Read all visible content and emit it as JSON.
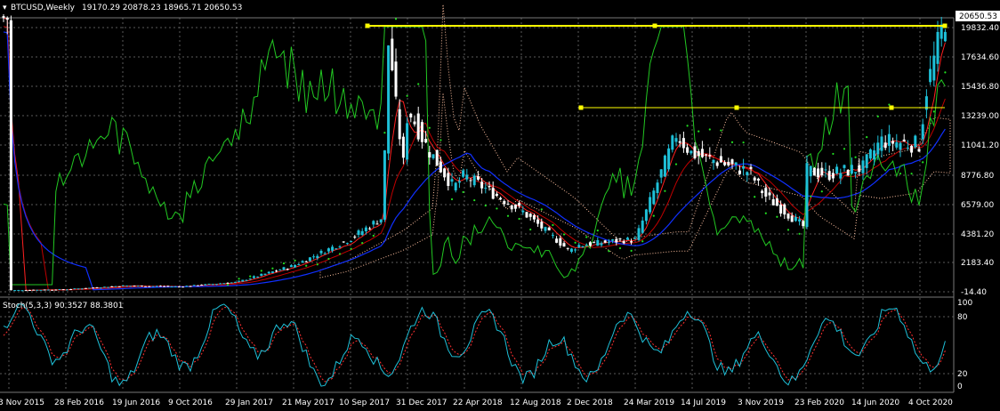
{
  "header": {
    "symbol": "BTCUSD,Weekly",
    "ohlc": "19170.29 20878.23 18965.71 20650.53"
  },
  "stoch": {
    "label": "Stoch(5,3,3) 90.3527 88.3801",
    "levels": [
      "100",
      "80",
      "20",
      "0"
    ]
  },
  "price_axis": [
    "19832.40",
    "17634.60",
    "15436.80",
    "13239.00",
    "11041.20",
    "8776.80",
    "6579.00",
    "4381.20",
    "2183.40",
    "-14.40"
  ],
  "current_price": "20650.53",
  "date_axis": [
    "3 Nov 2015",
    "28 Feb 2016",
    "19 Jun 2016",
    "9 Oct 2016",
    "29 Jan 2017",
    "21 May 2017",
    "10 Sep 2017",
    "31 Dec 2017",
    "22 Apr 2018",
    "12 Aug 2018",
    "2 Dec 2018",
    "24 Mar 2019",
    "14 Jul 2019",
    "3 Nov 2019",
    "23 Feb 2020",
    "14 Jun 2020",
    "4 Oct 2020"
  ],
  "colors": {
    "background": "#000000",
    "grid": "#5a5a5a",
    "candle_up": "#1ec0d8",
    "candle_down": "#ffffff",
    "fast_ma": "#ff2020",
    "mid_ma": "#c00000",
    "slow_ma": "#1030ff",
    "momentum": "#22c822",
    "psar": "#22e022",
    "cloud": "#ffc0a0",
    "resistance": "#ffff00",
    "stoch_main": "#1ec0d8",
    "stoch_signal": "#ff3030"
  },
  "chart_data": {
    "type": "candlestick",
    "title": "BTCUSD,Weekly",
    "ylim": [
      -14.4,
      20650.53
    ],
    "x": [
      "3 Nov 2015",
      "28 Feb 2016",
      "19 Jun 2016",
      "9 Oct 2016",
      "29 Jan 2017",
      "21 May 2017",
      "10 Sep 2017",
      "31 Dec 2017",
      "22 Apr 2018",
      "12 Aug 2018",
      "2 Dec 2018",
      "24 Mar 2019",
      "14 Jul 2019",
      "3 Nov 2019",
      "23 Feb 2020",
      "14 Jun 2020",
      "4 Oct 2020"
    ],
    "close": [
      360,
      430,
      700,
      640,
      970,
      2200,
      4200,
      14000,
      8900,
      6300,
      3700,
      4100,
      10500,
      9200,
      9300,
      9500,
      11200
    ],
    "last": {
      "open": 19170.29,
      "high": 20878.23,
      "low": 18965.71,
      "close": 20650.53
    },
    "resistance_levels": [
      19832.4,
      13600
    ],
    "stochastic": {
      "k": 5,
      "d": 3,
      "slowing": 3,
      "main": 90.3527,
      "signal": 88.3801
    }
  }
}
